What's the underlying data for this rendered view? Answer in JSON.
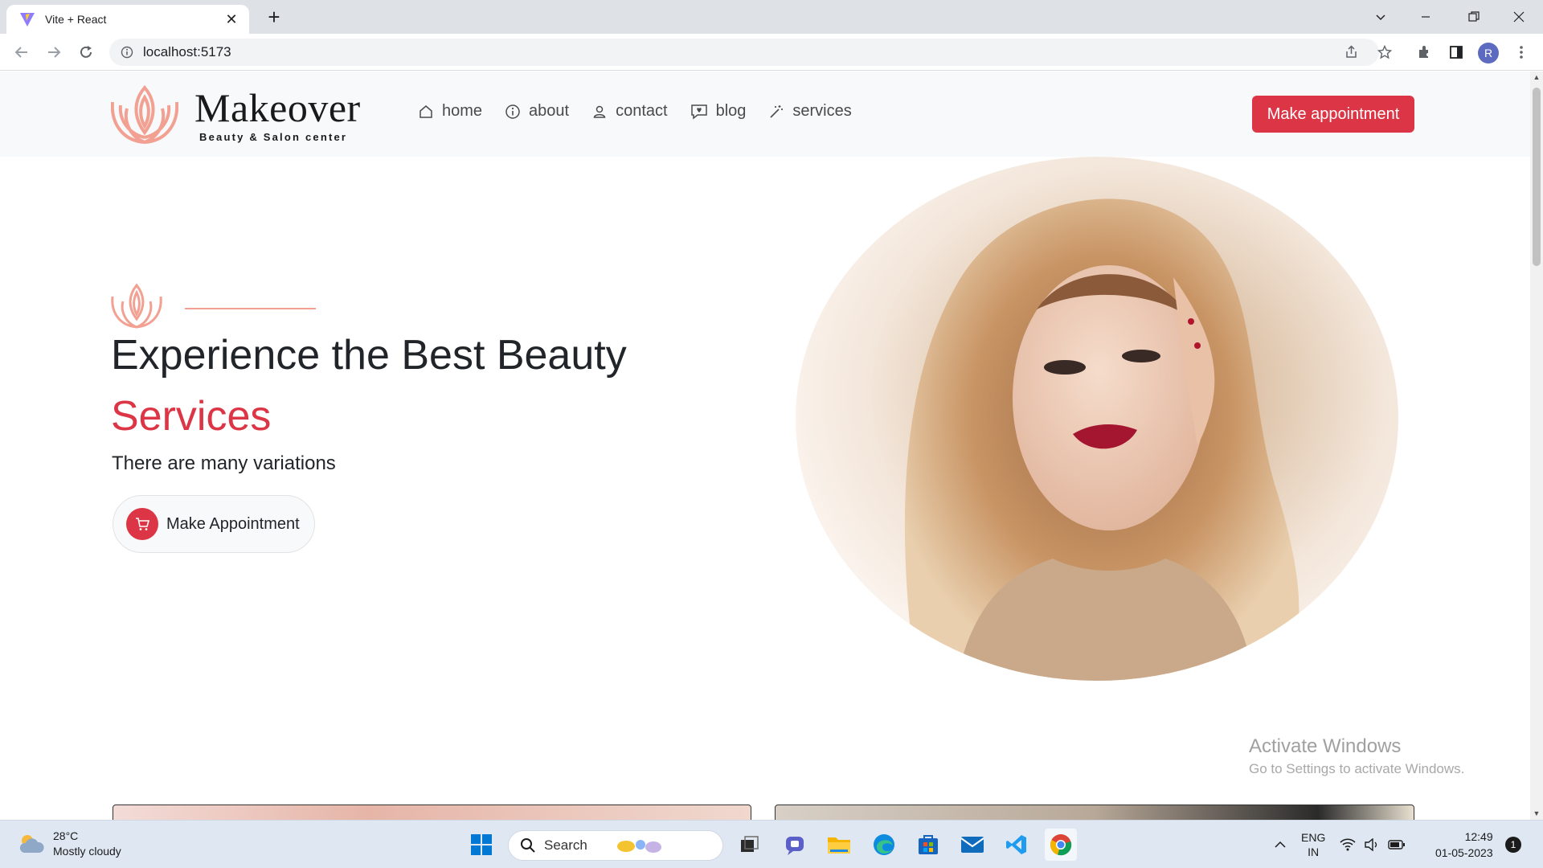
{
  "browser": {
    "tab_title": "Vite + React",
    "url": "localhost:5173",
    "profile_initial": "R"
  },
  "site": {
    "brand": "Makeover",
    "brand_sub": "Beauty & Salon center",
    "nav": [
      {
        "label": "home",
        "icon": "home-icon"
      },
      {
        "label": "about",
        "icon": "info-icon"
      },
      {
        "label": "contact",
        "icon": "user-icon"
      },
      {
        "label": "blog",
        "icon": "chat-icon"
      },
      {
        "label": "services",
        "icon": "magic-wand-icon"
      }
    ],
    "header_button": "Make appointment",
    "accent_color": "#dc3545",
    "logo_color": "#f2a092"
  },
  "hero": {
    "headline": "Experience the Best Beauty",
    "headline_accent": "Services",
    "tagline": "There are many variations",
    "cta_label": "Make Appointment",
    "cta_icon": "cart-icon"
  },
  "watermark": {
    "title": "Activate Windows",
    "subtitle": "Go to Settings to activate Windows."
  },
  "taskbar": {
    "weather_temp": "28°C",
    "weather_desc": "Mostly cloudy",
    "search_label": "Search",
    "lang_line1": "ENG",
    "lang_line2": "IN",
    "time": "12:49",
    "date": "01-05-2023",
    "notifications": "1"
  }
}
